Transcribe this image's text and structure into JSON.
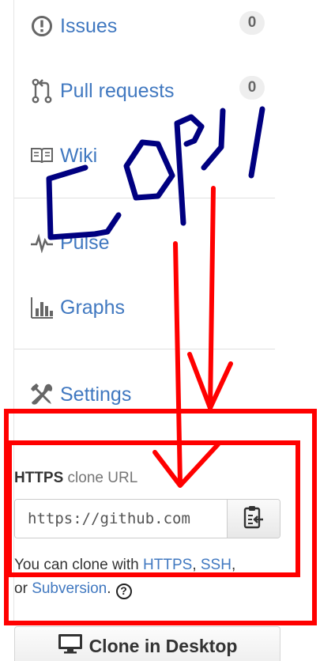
{
  "nav": {
    "items": [
      {
        "label": "Issues",
        "icon": "issue-opened-icon",
        "counter": "0"
      },
      {
        "label": "Pull requests",
        "icon": "git-pull-request-icon",
        "counter": "0"
      },
      {
        "label": "Wiki",
        "icon": "book-icon"
      },
      {
        "label": "Pulse",
        "icon": "pulse-icon"
      },
      {
        "label": "Graphs",
        "icon": "graph-icon"
      },
      {
        "label": "Settings",
        "icon": "tools-icon"
      }
    ]
  },
  "clone": {
    "protocol": "HTTPS",
    "title_suffix": " clone URL",
    "url": "https://github.com",
    "copy_icon": "clippy-icon",
    "help_prefix": "You can clone with ",
    "https_link": "HTTPS",
    "separator": ", ",
    "ssh_link": "SSH",
    "help_or": ",",
    "help_or2": "or ",
    "subversion_link": "Subversion",
    "help_period": ".",
    "help_icon": "?"
  },
  "desktop": {
    "label": "Clone in Desktop",
    "icon": "device-desktop-icon"
  },
  "annotation": {
    "text": "COPY",
    "colors": {
      "text": "#000080",
      "arrows": "#ff0000",
      "boxes": "#ff0000"
    }
  },
  "colors": {
    "link": "#4078c0",
    "muted": "#767676"
  }
}
